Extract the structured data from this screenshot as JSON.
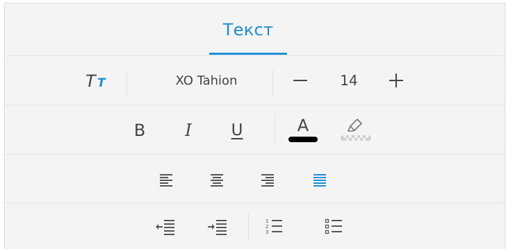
{
  "tabs": [
    {
      "label": "Текст",
      "active": true
    }
  ],
  "font": {
    "style_icon": "text-style-icon",
    "name": "XO Tahion",
    "size": "14",
    "decrease_icon": "minus-icon",
    "increase_icon": "plus-icon"
  },
  "style": {
    "bold": "B",
    "italic": "I",
    "underline": "U",
    "font_color": {
      "glyph": "A",
      "swatch": "#000000",
      "icon": "font-color-icon"
    },
    "highlight": {
      "icon": "highlighter-icon",
      "swatch": "transparent"
    }
  },
  "align": {
    "items": [
      {
        "icon": "align-left-icon",
        "active": false
      },
      {
        "icon": "align-center-icon",
        "active": false
      },
      {
        "icon": "align-right-icon",
        "active": false
      },
      {
        "icon": "align-justify-icon",
        "active": true
      }
    ]
  },
  "list": {
    "items": [
      {
        "icon": "indent-decrease-icon"
      },
      {
        "icon": "indent-increase-icon"
      },
      {
        "icon": "numbered-list-icon"
      },
      {
        "icon": "bulleted-list-icon"
      }
    ]
  },
  "colors": {
    "accent": "#1c8ed6",
    "icon": "#555555",
    "panel_bg": "#f4f4f4"
  }
}
